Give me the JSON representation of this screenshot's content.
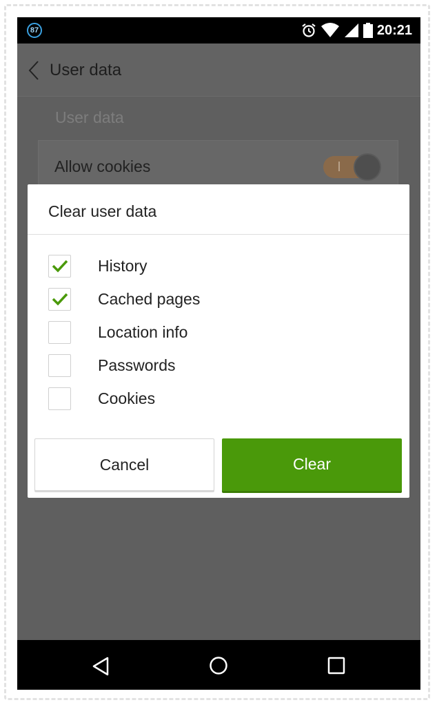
{
  "status_bar": {
    "notification_badge": "87",
    "icons": [
      "alarm-icon",
      "wifi-icon",
      "signal-icon",
      "battery-icon"
    ],
    "time": "20:21"
  },
  "app_bar": {
    "back_icon": "chevron-left-icon",
    "title": "User data"
  },
  "settings": {
    "section_label": "User data",
    "allow_cookies": {
      "label": "Allow cookies",
      "enabled": true
    }
  },
  "dialog": {
    "title": "Clear user data",
    "options": [
      {
        "label": "History",
        "checked": true
      },
      {
        "label": "Cached pages",
        "checked": true
      },
      {
        "label": "Location info",
        "checked": false
      },
      {
        "label": "Passwords",
        "checked": false
      },
      {
        "label": "Cookies",
        "checked": false
      }
    ],
    "cancel_label": "Cancel",
    "clear_label": "Clear"
  },
  "colors": {
    "accent_green": "#4a990a",
    "check_green": "#4a990a",
    "toggle_on": "#8a6a4a",
    "status_bar": "#000000",
    "scrim": "#5f5f5f"
  },
  "nav_bar": {
    "icons": [
      "nav-back-icon",
      "nav-home-icon",
      "nav-recents-icon"
    ]
  }
}
